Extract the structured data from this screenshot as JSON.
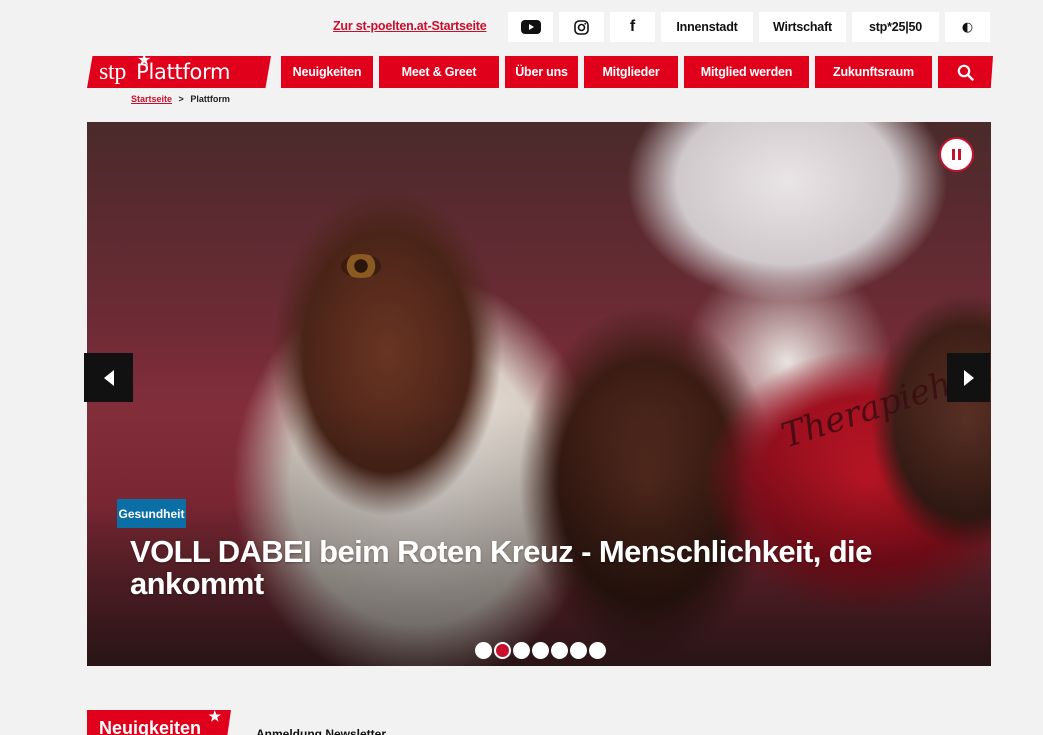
{
  "topbar": {
    "start_link": "Zur st-poelten.at-Startseite",
    "icons": [
      "youtube-icon",
      "instagram-icon",
      "facebook-icon"
    ],
    "facebook_glyph": "f",
    "innenstadt": "Innenstadt",
    "wirtschaft": "Wirtschaft",
    "stp2550": "stp*25|50",
    "contrast_glyph": "◐"
  },
  "logo": {
    "stp": "stp",
    "star": "★",
    "plattform": "Plattform"
  },
  "nav": {
    "items": [
      "Neuigkeiten",
      "Meet & Greet",
      "Über uns",
      "Mitglieder",
      "Mitglied werden",
      "Zukunftsraum"
    ],
    "search_icon": "search-icon"
  },
  "breadcrumb": {
    "home": "Startseite",
    "separator": ">",
    "current": "Plattform"
  },
  "hero": {
    "category": "Gesundheit",
    "headline": "VOLL DABEI beim Roten Kreuz - Menschlichkeit, die ankommt",
    "vest_text": "Therapiehund",
    "slide_count": 7,
    "active_slide": 2
  },
  "bottom": {
    "section_title": "Neuigkeiten",
    "section_star": "★",
    "newsletter": "Anmeldung Newsletter"
  },
  "colors": {
    "brand_red": "#e0001b",
    "tag_blue": "#0b6fa6"
  }
}
